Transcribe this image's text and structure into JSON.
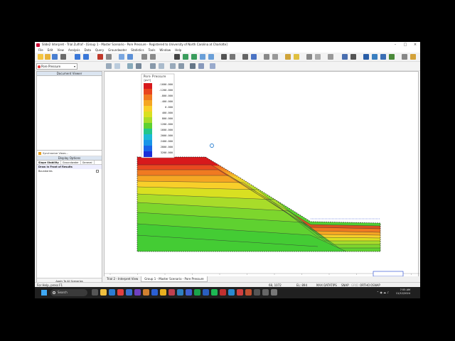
{
  "window": {
    "title": "Slide2 Interpret - Trial Zulfraf - [Group 1 - Master Scenario - Pore Pressure - Registered to University of North Carolina at Charlotte]",
    "buttons": [
      "–",
      "□",
      "×"
    ]
  },
  "menu": [
    "File",
    "Edit",
    "View",
    "Analysis",
    "Data",
    "Query",
    "Groundwater",
    "Statistics",
    "Tools",
    "Window",
    "Help"
  ],
  "toolbar": {
    "view_selector": "Pore Pressure"
  },
  "left_panel": {
    "document_viewer_title": "Document Viewer",
    "synchronize_label": "Synchronize Views...",
    "display_options_title": "Display Options",
    "tabs": [
      "Slope Stability",
      "Groundwater",
      "General"
    ],
    "group_label": "Draw in Front of Results",
    "boundaries_label": "Boundaries",
    "apply_button": "Apply To All Scenarios"
  },
  "legend": {
    "title": "Pore Pressure",
    "unit": "[psf]",
    "values": [
      "-1600.000",
      "-1200.000",
      "-800.000",
      "-400.000",
      "0.000",
      "400.000",
      "800.000",
      "1200.000",
      "1600.000",
      "2000.000",
      "2400.000",
      "2800.000",
      "3200.000"
    ],
    "colors": [
      "#d7191c",
      "#e8451f",
      "#f07a21",
      "#f5a623",
      "#f8cf2a",
      "#d9e021",
      "#a8dc2a",
      "#5fd130",
      "#24c78a",
      "#1cb9d6",
      "#1a95e8",
      "#1a63e8",
      "#1a2fd9"
    ]
  },
  "axis": {
    "ticks": [
      "-20",
      "0",
      "20",
      "40",
      "60",
      "80",
      "100",
      "120",
      "140",
      "160",
      "180",
      "200"
    ]
  },
  "tabs_bottom": [
    "Trial 2 - Interpret View",
    "Group 1 - Master Scenario - Pore Pressure"
  ],
  "status": {
    "help": "For Help, press F1",
    "coords": "68, 1072",
    "el": "EL: 894",
    "max_datatips": "MAX DATATIPS",
    "snap": "SNAP",
    "grid": "GRID",
    "ortho": "ORTHO",
    "osnap": "OSNAP"
  },
  "taskbar": {
    "search_placeholder": "Search",
    "time": "7:55 AM",
    "date": "11/12/2024"
  }
}
